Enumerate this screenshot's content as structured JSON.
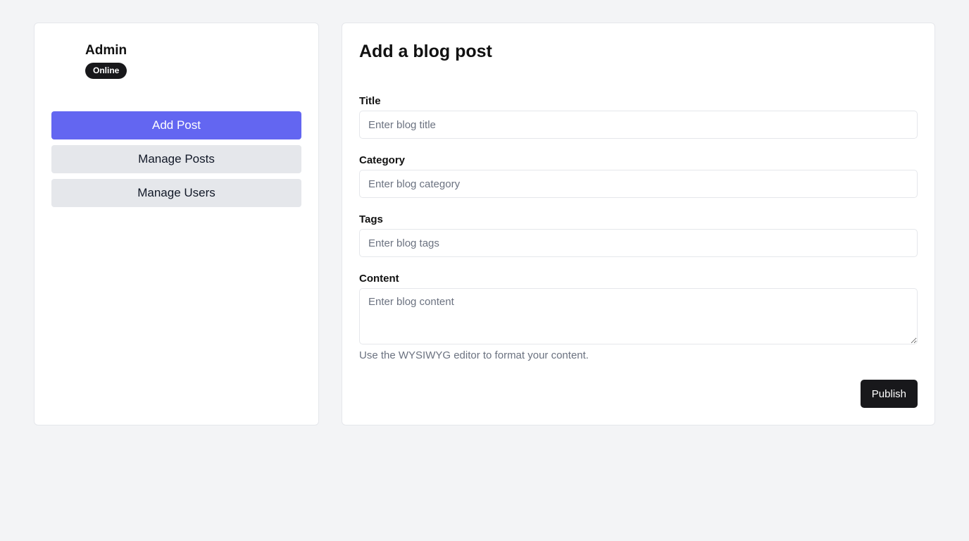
{
  "profile": {
    "name": "Admin",
    "status": "Online"
  },
  "nav": {
    "items": [
      {
        "label": "Add Post",
        "active": true
      },
      {
        "label": "Manage Posts",
        "active": false
      },
      {
        "label": "Manage Users",
        "active": false
      }
    ]
  },
  "form": {
    "title": "Add a blog post",
    "fields": {
      "title": {
        "label": "Title",
        "placeholder": "Enter blog title",
        "value": ""
      },
      "category": {
        "label": "Category",
        "placeholder": "Enter blog category",
        "value": ""
      },
      "tags": {
        "label": "Tags",
        "placeholder": "Enter blog tags",
        "value": ""
      },
      "content": {
        "label": "Content",
        "placeholder": "Enter blog content",
        "value": ""
      }
    },
    "help_text": "Use the WYSIWYG editor to format your content.",
    "publish_label": "Publish"
  },
  "colors": {
    "accent": "#6366f1",
    "page_background": "#f3f4f6",
    "badge_background": "#18181b",
    "nav_inactive": "#e5e7eb"
  }
}
